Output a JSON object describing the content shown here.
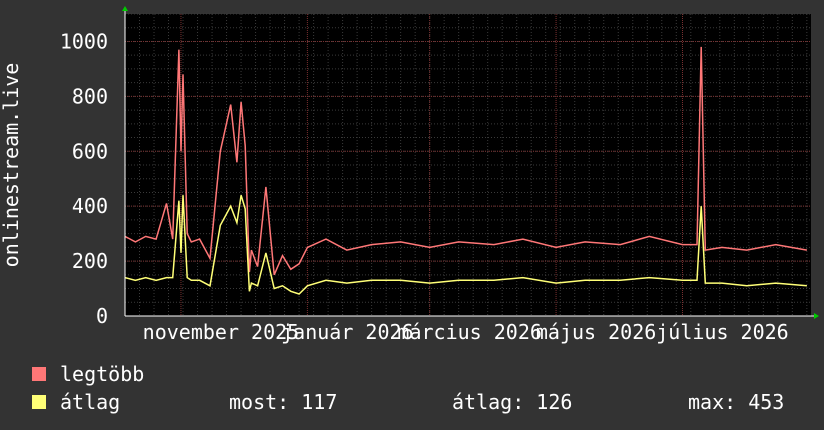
{
  "chart_data": {
    "type": "line",
    "ylabel": "onlinestream.live",
    "ylim": [
      0,
      1100
    ],
    "yticks": [
      0,
      200,
      400,
      600,
      800,
      1000
    ],
    "xlim": [
      "2025-10-05",
      "2026-09-01"
    ],
    "xticks": [
      {
        "label": "november 2025",
        "date": "2025-11-01"
      },
      {
        "label": "január 2026",
        "date": "2026-01-01"
      },
      {
        "label": "március 2026",
        "date": "2026-03-01"
      },
      {
        "label": "május 2026",
        "date": "2026-05-01"
      },
      {
        "label": "július 2026",
        "date": "2026-07-01"
      }
    ],
    "grid": true,
    "legend": "bottom-left",
    "series": [
      {
        "name": "legtöbb",
        "color": "#ff7777",
        "x": [
          "2025-10-05",
          "2025-10-10",
          "2025-10-15",
          "2025-10-20",
          "2025-10-25",
          "2025-10-28",
          "2025-10-31",
          "2025-11-01",
          "2025-11-02",
          "2025-11-04",
          "2025-11-06",
          "2025-11-10",
          "2025-11-15",
          "2025-11-20",
          "2025-11-25",
          "2025-11-28",
          "2025-11-30",
          "2025-12-02",
          "2025-12-04",
          "2025-12-05",
          "2025-12-08",
          "2025-12-12",
          "2025-12-16",
          "2025-12-20",
          "2025-12-24",
          "2025-12-28",
          "2026-01-01",
          "2026-01-10",
          "2026-01-20",
          "2026-02-01",
          "2026-02-15",
          "2026-03-01",
          "2026-03-15",
          "2026-04-01",
          "2026-04-15",
          "2026-05-01",
          "2026-05-15",
          "2026-06-01",
          "2026-06-15",
          "2026-07-01",
          "2026-07-08",
          "2026-07-10",
          "2026-07-12",
          "2026-07-20",
          "2026-08-01",
          "2026-08-15",
          "2026-08-30"
        ],
        "values": [
          290,
          270,
          290,
          280,
          410,
          280,
          970,
          600,
          880,
          300,
          270,
          280,
          210,
          600,
          770,
          560,
          780,
          620,
          160,
          240,
          180,
          470,
          150,
          220,
          170,
          190,
          250,
          280,
          240,
          260,
          270,
          250,
          270,
          260,
          280,
          250,
          270,
          260,
          290,
          260,
          260,
          980,
          240,
          250,
          240,
          260,
          240
        ]
      },
      {
        "name": "átlag",
        "color": "#ffff77",
        "x": [
          "2025-10-05",
          "2025-10-10",
          "2025-10-15",
          "2025-10-20",
          "2025-10-25",
          "2025-10-28",
          "2025-10-31",
          "2025-11-01",
          "2025-11-02",
          "2025-11-04",
          "2025-11-06",
          "2025-11-10",
          "2025-11-15",
          "2025-11-20",
          "2025-11-25",
          "2025-11-28",
          "2025-11-30",
          "2025-12-02",
          "2025-12-04",
          "2025-12-05",
          "2025-12-08",
          "2025-12-12",
          "2025-12-16",
          "2025-12-20",
          "2025-12-24",
          "2025-12-28",
          "2026-01-01",
          "2026-01-10",
          "2026-01-20",
          "2026-02-01",
          "2026-02-15",
          "2026-03-01",
          "2026-03-15",
          "2026-04-01",
          "2026-04-15",
          "2026-05-01",
          "2026-05-15",
          "2026-06-01",
          "2026-06-15",
          "2026-07-01",
          "2026-07-08",
          "2026-07-10",
          "2026-07-12",
          "2026-07-20",
          "2026-08-01",
          "2026-08-15",
          "2026-08-30"
        ],
        "values": [
          140,
          130,
          140,
          130,
          140,
          140,
          420,
          230,
          440,
          140,
          130,
          130,
          110,
          330,
          400,
          340,
          440,
          390,
          90,
          120,
          110,
          230,
          100,
          110,
          90,
          80,
          110,
          130,
          120,
          130,
          130,
          120,
          130,
          130,
          140,
          120,
          130,
          130,
          140,
          130,
          130,
          400,
          120,
          120,
          110,
          120,
          110
        ]
      }
    ]
  },
  "legend": {
    "items": [
      {
        "label": "legtöbb",
        "color": "#ff7777"
      },
      {
        "label": "átlag",
        "color": "#ffff77"
      }
    ],
    "stats": {
      "most": "most: 117",
      "atlag": "átlag: 126",
      "max": "max: 453"
    }
  }
}
